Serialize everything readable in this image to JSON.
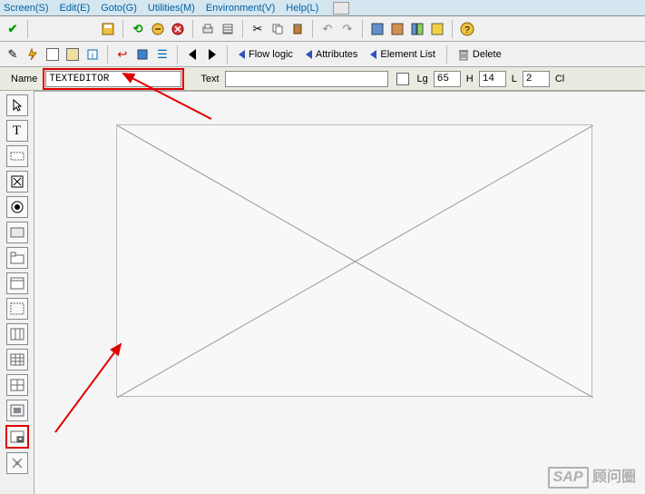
{
  "menubar": {
    "screen": "Screen(S)",
    "edit": "Edit(E)",
    "goto": "Goto(G)",
    "utilities": "Utilities(M)",
    "environment": "Environment(V)",
    "help": "Help(L)"
  },
  "toolbar2": {
    "flow_logic": "Flow logic",
    "attributes": "Attributes",
    "element_list": "Element List",
    "delete": "Delete"
  },
  "form": {
    "name_label": "Name",
    "name_value": "TEXTEDITOR",
    "text_label": "Text",
    "text_value": "",
    "lg_label": "Lg",
    "lg_value": "65",
    "h_label": "H",
    "h_value": "14",
    "l_label": "L",
    "l_value": "2",
    "cl_label": "Cl"
  },
  "watermark": {
    "sap": "SAP",
    "cn": "顾问圈"
  }
}
